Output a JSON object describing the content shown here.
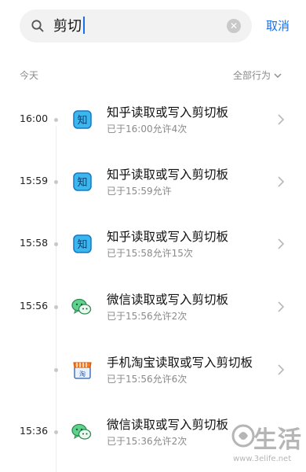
{
  "search": {
    "query": "剪切",
    "cancel_label": "取消"
  },
  "section": {
    "date_label": "今天",
    "filter_label": "全部行为"
  },
  "records": [
    {
      "time": "16:00",
      "app": "zhihu",
      "title": "知乎读取或写入剪切板",
      "detail": "已于16:00允许4次",
      "show_time": true
    },
    {
      "time": "15:59",
      "app": "zhihu",
      "title": "知乎读取或写入剪切板",
      "detail": "已于15:59允许",
      "show_time": true
    },
    {
      "time": "15:58",
      "app": "zhihu",
      "title": "知乎读取或写入剪切板",
      "detail": "已于15:58允许15次",
      "show_time": true
    },
    {
      "time": "15:56",
      "app": "wechat",
      "title": "微信读取或写入剪切板",
      "detail": "已于15:56允许2次",
      "show_time": true
    },
    {
      "time": "",
      "app": "taobao",
      "title": "手机淘宝读取或写入剪切板",
      "detail": "已于15:56允许6次",
      "show_time": false
    },
    {
      "time": "15:36",
      "app": "wechat",
      "title": "微信读取或写入剪切板",
      "detail": "已于15:36允许2次",
      "show_time": true
    }
  ],
  "icons": {
    "zhihu": {
      "name": "zhihu-app-icon",
      "glyph": "知",
      "color": "#2aa7e8"
    },
    "wechat": {
      "name": "wechat-app-icon",
      "color": "#21c55d"
    },
    "taobao": {
      "name": "taobao-app-icon",
      "glyph": "淘",
      "color": "#ff6a00"
    }
  },
  "watermark": {
    "text": "生活",
    "url": "www.3elife.net"
  }
}
